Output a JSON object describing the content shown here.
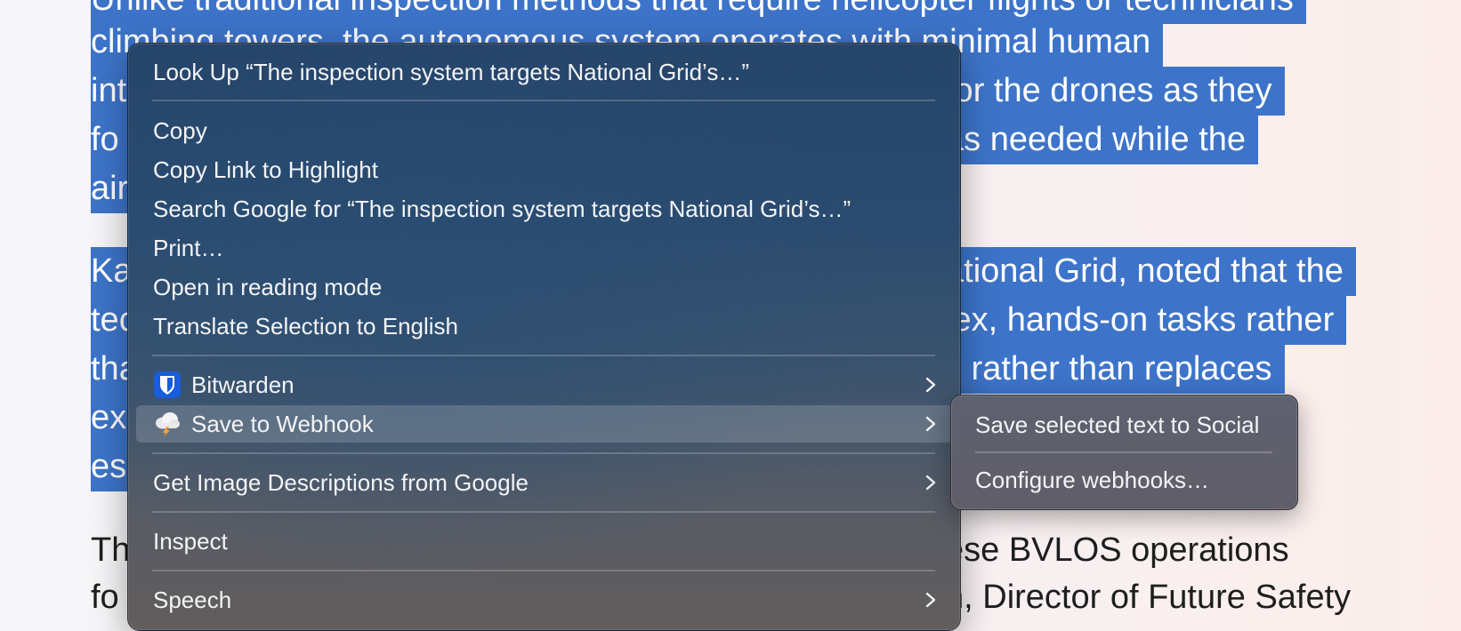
{
  "article": {
    "lines": [
      "Unlike traditional inspection methods that require helicopter flights or technicians",
      "climbing towers, the autonomous system operates with minimal human",
      "int",
      "tor the drones as they",
      "fo",
      "as needed while the",
      "air",
      "Ka",
      "ational Grid, noted that the",
      "tec",
      "lex, hands-on tasks rather",
      "tha",
      "s rather than replaces",
      "ex",
      "es",
      "Th",
      "ese BVLOS operations",
      "fo",
      "n, Director of Future Safety"
    ]
  },
  "context_menu": {
    "look_up": "Look Up “The inspection system targets National Grid’s…”",
    "copy": "Copy",
    "copy_link": "Copy Link to Highlight",
    "search_google": "Search Google for “The inspection system targets National Grid’s…”",
    "print": "Print…",
    "reading_mode": "Open in reading mode",
    "translate": "Translate Selection to English",
    "bitwarden": "Bitwarden",
    "save_webhook": "Save to Webhook",
    "image_descriptions": "Get Image Descriptions from Google",
    "inspect": "Inspect",
    "speech": "Speech"
  },
  "submenu": {
    "save_selected": "Save selected text to Social",
    "configure": "Configure webhooks…"
  },
  "colors": {
    "selection": "#3d74c9",
    "menu_text": "#f3f4f6",
    "bitwarden": "#175ddc"
  },
  "icons": {
    "bitwarden": "bitwarden-shield-icon",
    "webhook": "storm-cloud-icon",
    "submenu": "chevron-right-icon"
  }
}
